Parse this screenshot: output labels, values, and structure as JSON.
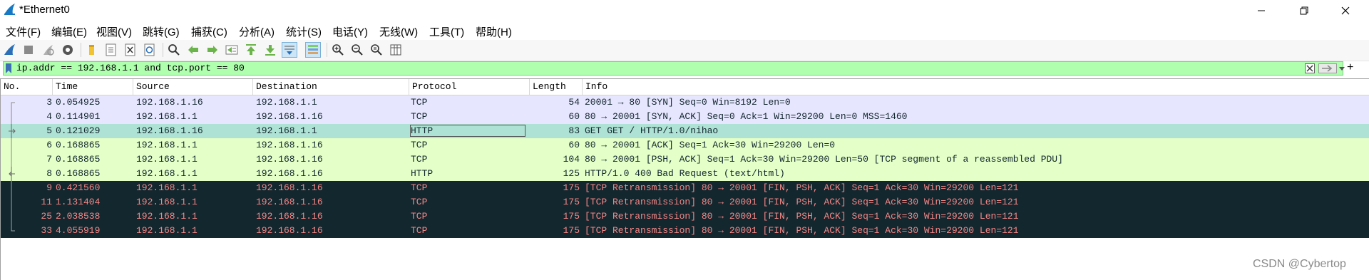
{
  "window": {
    "title": "*Ethernet0",
    "app_icon": "wireshark-fin-icon"
  },
  "menu": [
    {
      "label": "文件(F)"
    },
    {
      "label": "编辑(E)"
    },
    {
      "label": "视图(V)"
    },
    {
      "label": "跳转(G)"
    },
    {
      "label": "捕获(C)"
    },
    {
      "label": "分析(A)"
    },
    {
      "label": "统计(S)"
    },
    {
      "label": "电话(Y)"
    },
    {
      "label": "无线(W)"
    },
    {
      "label": "工具(T)"
    },
    {
      "label": "帮助(H)"
    }
  ],
  "toolbar": [
    {
      "icon": "start-capture-fin-icon"
    },
    {
      "icon": "stop-capture-icon"
    },
    {
      "icon": "restart-capture-icon"
    },
    {
      "icon": "capture-options-icon"
    },
    {
      "icon": "open-file-icon"
    },
    {
      "icon": "save-file-icon"
    },
    {
      "icon": "close-file-icon"
    },
    {
      "icon": "reload-file-icon"
    },
    {
      "icon": "find-packet-icon"
    },
    {
      "icon": "go-back-icon"
    },
    {
      "icon": "go-forward-icon"
    },
    {
      "icon": "go-to-packet-icon"
    },
    {
      "icon": "go-first-icon"
    },
    {
      "icon": "go-last-icon"
    },
    {
      "icon": "autoscroll-icon"
    },
    {
      "icon": "colorize-icon"
    },
    {
      "icon": "zoom-in-icon"
    },
    {
      "icon": "zoom-out-icon"
    },
    {
      "icon": "zoom-normal-icon"
    },
    {
      "icon": "resize-columns-icon"
    }
  ],
  "filter": {
    "value": "ip.addr == 192.168.1.1 and tcp.port == 80",
    "bg_color": "#afffaf"
  },
  "columns": [
    "No.",
    "Time",
    "Source",
    "Destination",
    "Protocol",
    "Length",
    "Info"
  ],
  "packets": [
    {
      "no": "3",
      "time": "0.054925",
      "src": "192.168.1.16",
      "dst": "192.168.1.1",
      "proto": "TCP",
      "len": "54",
      "info": "20001 → 80 [SYN] Seq=0 Win=8192 Len=0",
      "bg": "#e7e6ff",
      "fg": "#12272e",
      "selected": false
    },
    {
      "no": "4",
      "time": "0.114901",
      "src": "192.168.1.1",
      "dst": "192.168.1.16",
      "proto": "TCP",
      "len": "60",
      "info": "80 → 20001 [SYN, ACK] Seq=0 Ack=1 Win=29200 Len=0 MSS=1460",
      "bg": "#e7e6ff",
      "fg": "#12272e",
      "selected": false
    },
    {
      "no": "5",
      "time": "0.121029",
      "src": "192.168.1.16",
      "dst": "192.168.1.1",
      "proto": "HTTP",
      "len": "83",
      "info": "GET GET / HTTP/1.0/nihao",
      "bg": "#aee2d4",
      "fg": "#12272e",
      "selected": true
    },
    {
      "no": "6",
      "time": "0.168865",
      "src": "192.168.1.1",
      "dst": "192.168.1.16",
      "proto": "TCP",
      "len": "60",
      "info": "80 → 20001 [ACK] Seq=1 Ack=30 Win=29200 Len=0",
      "bg": "#e4ffc7",
      "fg": "#12272e",
      "selected": false
    },
    {
      "no": "7",
      "time": "0.168865",
      "src": "192.168.1.1",
      "dst": "192.168.1.16",
      "proto": "TCP",
      "len": "104",
      "info": "80 → 20001 [PSH, ACK] Seq=1 Ack=30 Win=29200 Len=50 [TCP segment of a reassembled PDU]",
      "bg": "#e4ffc7",
      "fg": "#12272e",
      "selected": false
    },
    {
      "no": "8",
      "time": "0.168865",
      "src": "192.168.1.1",
      "dst": "192.168.1.16",
      "proto": "HTTP",
      "len": "125",
      "info": "HTTP/1.0 400 Bad Request  (text/html)",
      "bg": "#e4ffc7",
      "fg": "#12272e",
      "selected": false
    },
    {
      "no": "9",
      "time": "0.421560",
      "src": "192.168.1.1",
      "dst": "192.168.1.16",
      "proto": "TCP",
      "len": "175",
      "info": "[TCP Retransmission] 80 → 20001 [FIN, PSH, ACK] Seq=1 Ack=30 Win=29200 Len=121",
      "bg": "#12272e",
      "fg": "#f78787",
      "selected": false
    },
    {
      "no": "11",
      "time": "1.131404",
      "src": "192.168.1.1",
      "dst": "192.168.1.16",
      "proto": "TCP",
      "len": "175",
      "info": "[TCP Retransmission] 80 → 20001 [FIN, PSH, ACK] Seq=1 Ack=30 Win=29200 Len=121",
      "bg": "#12272e",
      "fg": "#f78787",
      "selected": false
    },
    {
      "no": "25",
      "time": "2.038538",
      "src": "192.168.1.1",
      "dst": "192.168.1.16",
      "proto": "TCP",
      "len": "175",
      "info": "[TCP Retransmission] 80 → 20001 [FIN, PSH, ACK] Seq=1 Ack=30 Win=29200 Len=121",
      "bg": "#12272e",
      "fg": "#f78787",
      "selected": false
    },
    {
      "no": "33",
      "time": "4.055919",
      "src": "192.168.1.1",
      "dst": "192.168.1.16",
      "proto": "TCP",
      "len": "175",
      "info": "[TCP Retransmission] 80 → 20001 [FIN, PSH, ACK] Seq=1 Ack=30 Win=29200 Len=121",
      "bg": "#12272e",
      "fg": "#f78787",
      "selected": false
    }
  ],
  "watermark": "CSDN @Cybertop"
}
